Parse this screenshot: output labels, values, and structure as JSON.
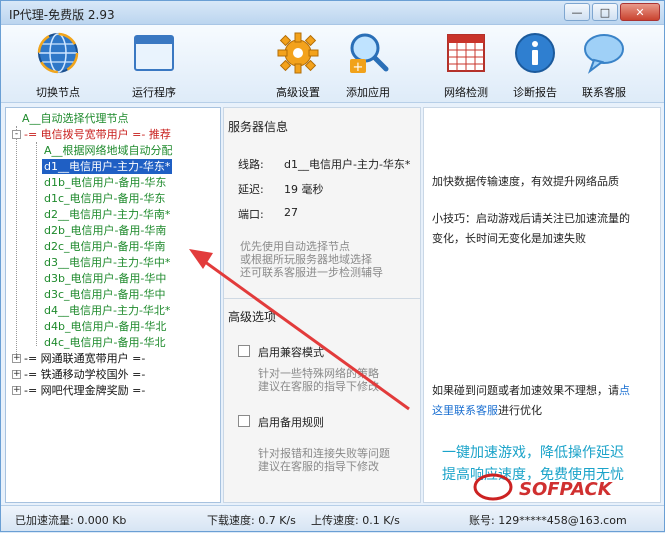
{
  "window": {
    "title": "IP代理-免费版 2.93",
    "min": "—",
    "max": "□",
    "close": "✕"
  },
  "toolbar": {
    "items": [
      {
        "label": "切换节点",
        "icon": "globe-icon"
      },
      {
        "label": "运行程序",
        "icon": "window-icon"
      },
      {
        "label": "高级设置",
        "icon": "gear-icon"
      },
      {
        "label": "添加应用",
        "icon": "magnifier-plus-icon"
      },
      {
        "label": "网络检测",
        "icon": "calendar-grid-icon"
      },
      {
        "label": "诊断报告",
        "icon": "info-icon"
      },
      {
        "label": "联系客服",
        "icon": "chat-bubble-icon"
      }
    ]
  },
  "tree": {
    "root_auto": "A__自动选择代理节点",
    "group_telecom": "-= 电信拨号宽带用户 =- 推荐",
    "telecom_auto": "A__根据网络地域自动分配",
    "nodes": [
      "d1__电信用户-主力-华东*",
      "d1b_电信用户-备用-华东",
      "d1c_电信用户-备用-华东",
      "d2__电信用户-主力-华南*",
      "d2b_电信用户-备用-华南",
      "d2c_电信用户-备用-华南",
      "d3__电信用户-主力-华中*",
      "d3b_电信用户-备用-华中",
      "d3c_电信用户-备用-华中",
      "d4__电信用户-主力-华北*",
      "d4b_电信用户-备用-华北",
      "d4c_电信用户-备用-华北"
    ],
    "group_unicom": "-= 网通联通宽带用户 =-",
    "group_tietong": "-= 铁通移动学校国外 =-",
    "group_netbar": "-= 网吧代理金牌奖励 =-",
    "expand_plus": "+",
    "expand_minus": "-"
  },
  "server": {
    "heading": "服务器信息",
    "route_label": "线路:",
    "route_value": "d1__电信用户-主力-华东*",
    "latency_label": "延迟:",
    "latency_value": "19 毫秒",
    "port_label": "端口:",
    "port_value": "27",
    "hint1": "优先使用自动选择节点",
    "hint2": "或根据所玩服务器地域选择",
    "hint3": "还可联系客服进一步检测辅导"
  },
  "advanced": {
    "heading": "高级选项",
    "compat_label": "启用兼容模式",
    "compat_desc1": "针对一些特殊网络的策略",
    "compat_desc2": "建议在客服的指导下修改",
    "backup_label": "启用备用规则",
    "backup_desc1": "针对报错和连接失败等问题",
    "backup_desc2": "建议在客服的指导下修改"
  },
  "info": {
    "line1": "加快数据传输速度，有效提升网络品质",
    "tip1": "小技巧：启动游戏后请关注已加速流量的",
    "tip2": "变化，长时间无变化是加速失败",
    "problem1_prefix": "如果碰到问题或者加速效果不理想，请",
    "problem1_link": "点",
    "problem2_link": "这里联系客服",
    "problem2_suffix": "进行优化",
    "promo1": "一键加速游戏，降低操作延迟",
    "promo2": "提高响应速度，免费使用无忧"
  },
  "status": {
    "traffic": "已加速流量: 0.000 Kb",
    "download": "下载速度: 0.7 K/s",
    "upload": "上传速度: 0.1 K/s",
    "account": "账号: 129*****458@163.com"
  },
  "watermark": {
    "text": "SOFPACK"
  },
  "colors": {
    "selected": "#1f5fc4",
    "node_green": "#1e8a2c",
    "group_red": "#c8201e",
    "annotation_arrow": "#e23b3b",
    "link": "#1a6fd1",
    "promo": "#1ba3c9"
  }
}
